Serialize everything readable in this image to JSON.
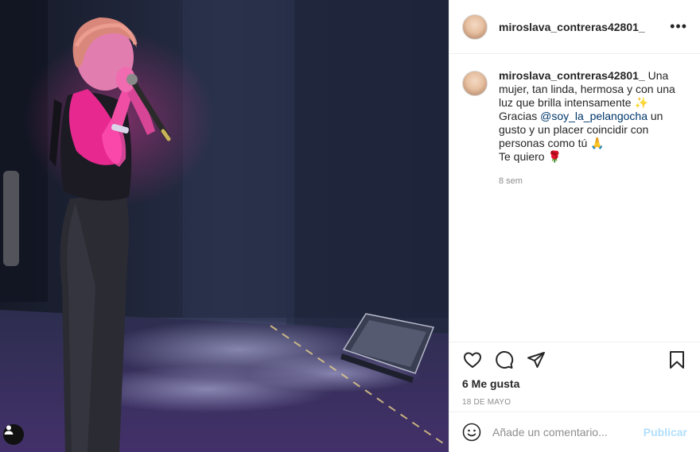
{
  "post": {
    "username": "miroslava_contreras42801_",
    "more_icon": "more-horizontal-icon",
    "caption": {
      "username": "miroslava_contreras42801_",
      "text_1": " Una mujer, tan linda, hermosa y con una luz que brilla intensamente ",
      "emoji_1": "✨",
      "text_2": "Gracias ",
      "mention": "@soy_la_pelangocha",
      "text_3": " un gusto y un placer coincidir con personas como tú ",
      "emoji_2": "🙏",
      "text_4": "Te quiero ",
      "emoji_3": "🌹",
      "time": "8 sem"
    },
    "likes": "6 Me gusta",
    "date": "18 DE MAYO",
    "comment": {
      "placeholder": "Añade un comentario...",
      "post_label": "Publicar"
    }
  },
  "icons": {
    "like": "heart-icon",
    "comment": "comment-icon",
    "share": "share-icon",
    "save": "bookmark-icon",
    "emoji": "emoji-icon",
    "user_tag": "user-tag-icon"
  },
  "colors": {
    "link": "#00376b",
    "muted": "#8e8e8e",
    "post_button_disabled": "#b2dffc",
    "stage_light": "#e0308c"
  }
}
